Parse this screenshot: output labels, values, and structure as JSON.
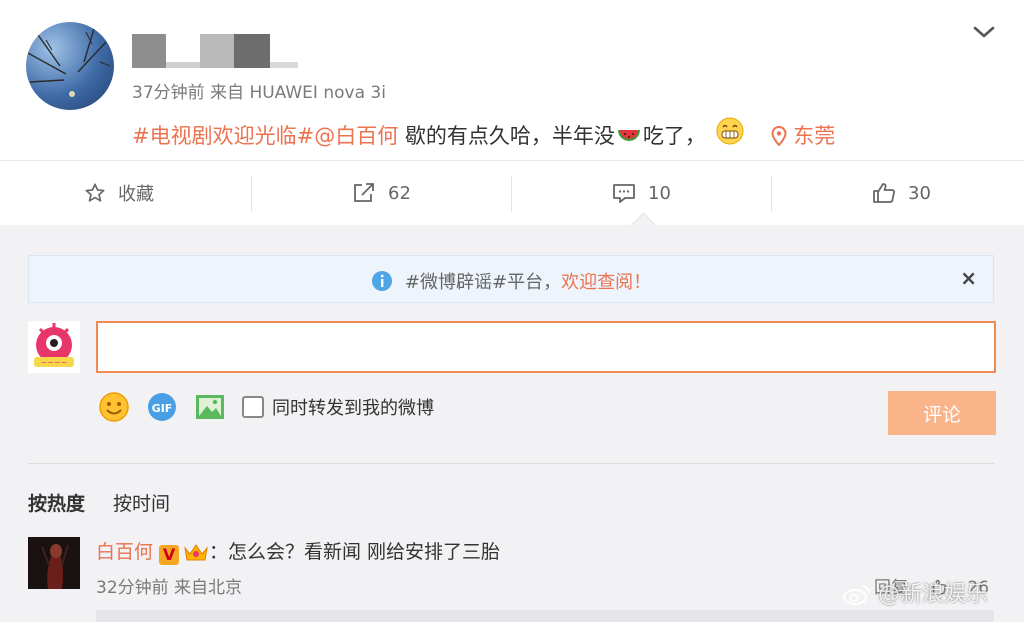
{
  "post": {
    "time": "37分钟前",
    "source": "来自 HUAWEI nova 3i",
    "topic": "#电视剧欢迎光临#",
    "mention": "@白百何",
    "text_main": "歇的有点久哈，半年没",
    "text_tail": "吃了，",
    "location": "东莞"
  },
  "actions": {
    "favorite_label": "收藏",
    "repost_count": "62",
    "comment_count": "10",
    "like_count": "30"
  },
  "notice": {
    "topic": "#微博辟谣#平台，",
    "highlight": "欢迎查阅！",
    "close": "×"
  },
  "composer": {
    "input_value": "",
    "repost_checkbox_label": "同时转发到我的微博",
    "submit_label": "评论"
  },
  "sort": {
    "by_hot": "按热度",
    "by_time": "按时间"
  },
  "comment": {
    "author": "白百何",
    "vbadge": "V",
    "text": "：怎么会？看新闻 刚给安排了三胎",
    "time": "32分钟前",
    "source": "来自北京",
    "reply_label": "回复",
    "like_count": "26"
  },
  "watermark": "@新浪娱乐",
  "colors": {
    "accent": "#eb7350",
    "submit_disabled": "#f9b48a",
    "input_border": "#f08a53",
    "comment_bg": "#f2f2f5"
  }
}
